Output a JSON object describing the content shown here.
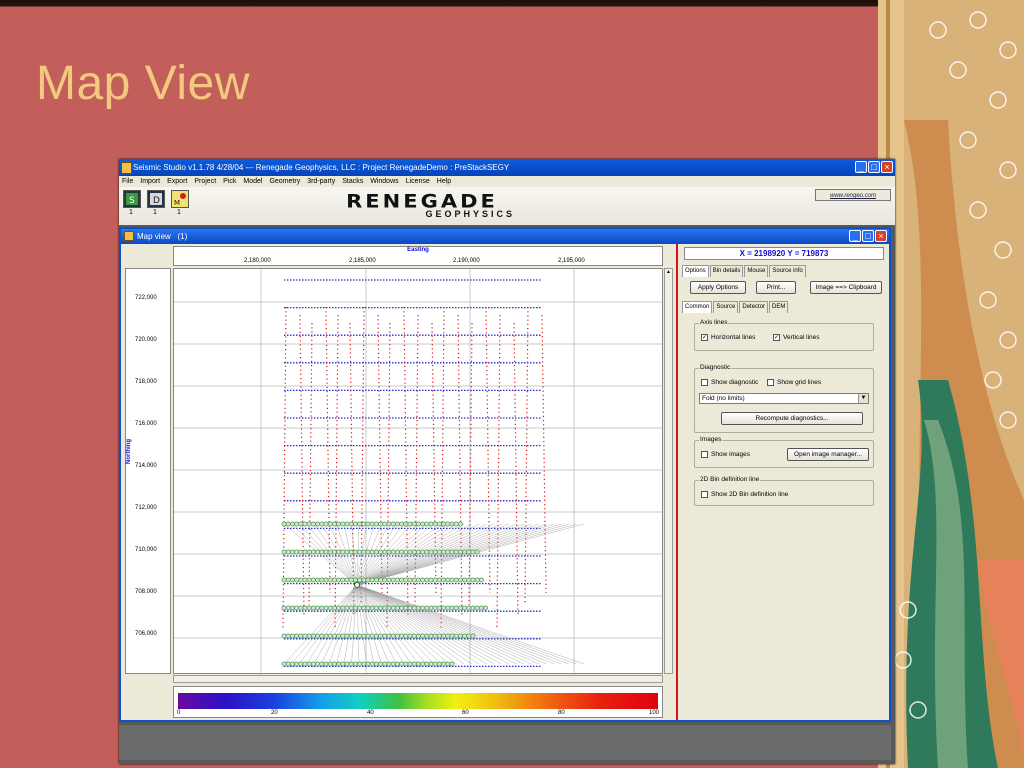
{
  "slide": {
    "title": "Map View"
  },
  "app": {
    "title": "Seismic Studio v1.1.78 4/28/04 ---  Renegade Geophysics, LLC   : Project RenegadeDemo  : PreStackSEGY",
    "menu": [
      "File",
      "Import",
      "Export",
      "Project",
      "Pick",
      "Model",
      "Geometry",
      "3rd-party",
      "Stacks",
      "Windows",
      "License",
      "Help"
    ],
    "toolbar": {
      "buttons": [
        {
          "icon": "s-badge-icon",
          "count": "1"
        },
        {
          "icon": "d-badge-icon",
          "count": "1"
        },
        {
          "icon": "m-badge-icon",
          "count": "1"
        }
      ],
      "logo_main": "RENEGADE",
      "logo_sub": "GEOPHYSICS",
      "weblink": "www.rengeo.com"
    }
  },
  "mapview": {
    "title": "Map view",
    "count": "(1)",
    "x_axis_title": "Easting",
    "y_axis_title": "Northing",
    "x_ticks": [
      "2,180,000",
      "2,185,000",
      "2,190,000",
      "2,195,000"
    ],
    "y_ticks": [
      "722,000",
      "720,000",
      "718,000",
      "716,000",
      "714,000",
      "712,000",
      "710,000",
      "708,000",
      "706,000"
    ],
    "colorbar_ticks": [
      "0",
      "20",
      "40",
      "60",
      "80",
      "100"
    ]
  },
  "panel": {
    "coords": "X = 2198920  Y = 719873",
    "tabs": [
      "Options",
      "Bin details",
      "Mouse",
      "Source info"
    ],
    "apply_options": "Apply Options",
    "print": "Print...",
    "clipboard": "Image ==> Clipboard",
    "subtabs": [
      "Common",
      "Source",
      "Detector",
      "DEM"
    ],
    "axis_lines_label": "Axis lines",
    "horizontal_lines": "Horizontal lines",
    "vertical_lines": "Vertical lines",
    "diagnostic_label": "Diagnostic",
    "show_diagnostic": "Show diagnostic",
    "show_grid_lines": "Show grid lines",
    "fold_select": "Fold (no limits)",
    "recompute": "Recompute diagnostics...",
    "images_label": "Images",
    "show_images": "Show images",
    "open_image_manager": "Open image manager...",
    "bin2d_label": "2D Bin definition line",
    "show_2d_bin": "Show 2D Bin definition line",
    "horizontal_checked": true,
    "vertical_checked": true
  }
}
